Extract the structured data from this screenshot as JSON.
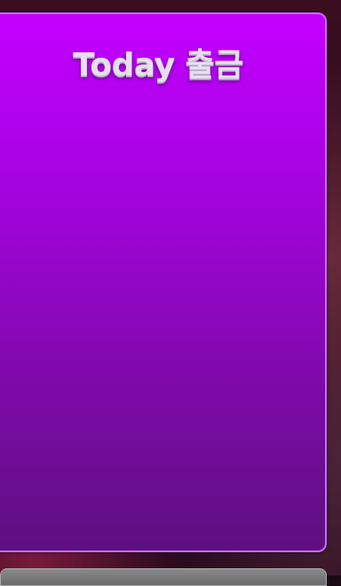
{
  "panel": {
    "title": "Today 출금"
  },
  "colors": {
    "panel_top": "#c300ff",
    "panel_bottom": "#5d1080",
    "panel_border": "#c86bff",
    "title_text": "#e6dff0"
  }
}
